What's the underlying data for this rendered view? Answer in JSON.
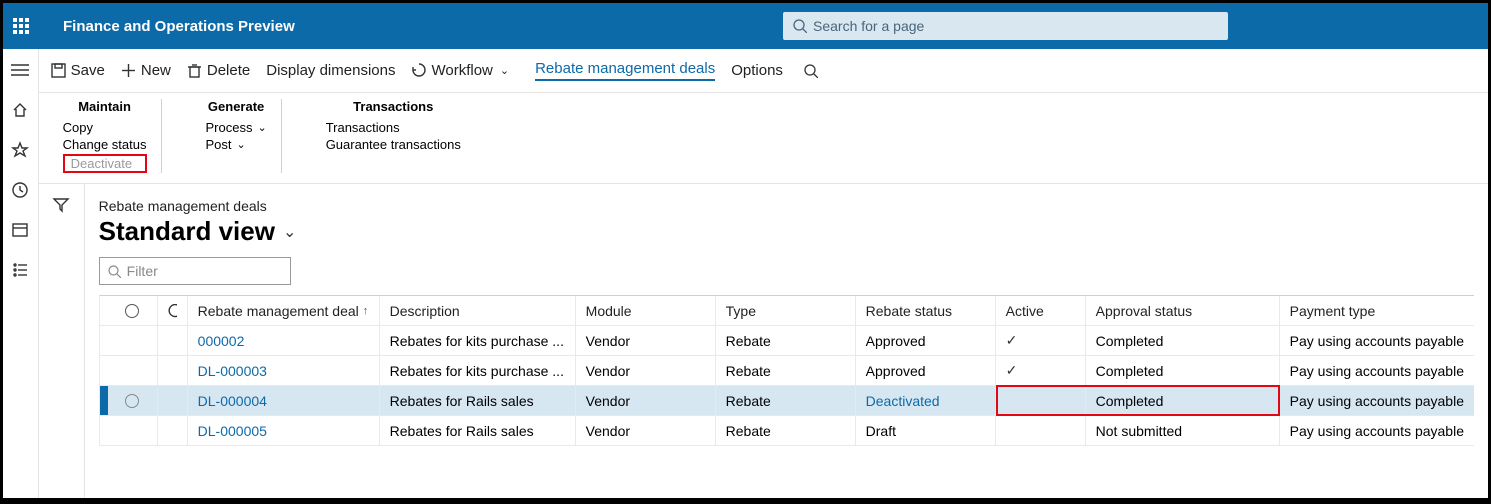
{
  "header": {
    "app_title": "Finance and Operations Preview",
    "search_placeholder": "Search for a page"
  },
  "actionbar": {
    "save": "Save",
    "new": "New",
    "delete": "Delete",
    "display_dimensions": "Display dimensions",
    "workflow": "Workflow",
    "active_tab": "Rebate management deals",
    "options": "Options"
  },
  "ribbon": {
    "maintain": {
      "title": "Maintain",
      "copy": "Copy",
      "change_status": "Change status",
      "deactivate": "Deactivate"
    },
    "generate": {
      "title": "Generate",
      "process": "Process",
      "post": "Post"
    },
    "transactions": {
      "title": "Transactions",
      "transactions": "Transactions",
      "guarantee": "Guarantee transactions"
    }
  },
  "page": {
    "breadcrumb": "Rebate management deals",
    "view_title": "Standard view",
    "filter_placeholder": "Filter"
  },
  "grid": {
    "columns": {
      "deal": "Rebate management deal",
      "description": "Description",
      "module": "Module",
      "type": "Type",
      "rebate_status": "Rebate status",
      "active": "Active",
      "approval_status": "Approval status",
      "payment_type": "Payment type"
    },
    "rows": [
      {
        "deal": "000002",
        "description": "Rebates for kits purchase ...",
        "module": "Vendor",
        "type": "Rebate",
        "rebate_status": "Approved",
        "active": "✓",
        "approval": "Completed",
        "payment": "Pay using accounts payable",
        "selected": false
      },
      {
        "deal": "DL-000003",
        "description": "Rebates for kits purchase ...",
        "module": "Vendor",
        "type": "Rebate",
        "rebate_status": "Approved",
        "active": "✓",
        "approval": "Completed",
        "payment": "Pay using accounts payable",
        "selected": false
      },
      {
        "deal": "DL-000004",
        "description": "Rebates for Rails sales",
        "module": "Vendor",
        "type": "Rebate",
        "rebate_status": "Deactivated",
        "active": "",
        "approval": "Completed",
        "payment": "Pay using accounts payable",
        "selected": true
      },
      {
        "deal": "DL-000005",
        "description": "Rebates for Rails sales",
        "module": "Vendor",
        "type": "Rebate",
        "rebate_status": "Draft",
        "active": "",
        "approval": "Not submitted",
        "payment": "Pay using accounts payable",
        "selected": false
      }
    ]
  }
}
